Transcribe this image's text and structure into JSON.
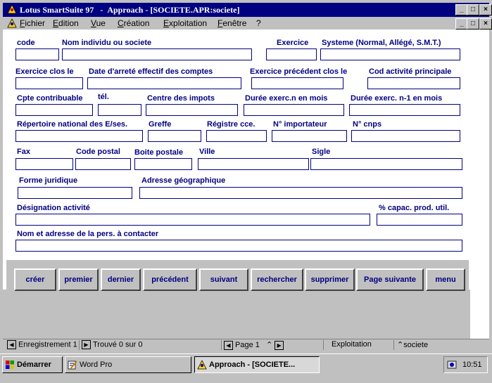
{
  "window": {
    "app_name": "Lotus SmartSuite 97",
    "separator": "-",
    "doc_title": "Approach - [SOCIETE.APR:societe]",
    "min_btn": "_",
    "max_btn": "□",
    "close_btn": "×"
  },
  "menu": {
    "items": [
      "Fichier",
      "Edition",
      "Vue",
      "Création",
      "Exploitation",
      "Fenêtre",
      "?"
    ],
    "doc_min": "_",
    "doc_max": "□",
    "doc_close": "×"
  },
  "form": {
    "labels": {
      "code": "code",
      "nom": "Nom individu ou societe",
      "exercice": "Exercice",
      "systeme": "Systeme (Normal, Allégé, S.M.T.)",
      "exercice_clos": "Exercice clos le",
      "date_arrete": "Date d'arreté effectif des comptes",
      "exercice_prec": "Exercice précédent clos le",
      "cod_activite": "Cod activité principale",
      "cpte": "Cpte contribuable",
      "tel": "tél.",
      "centre": "Centre des impots",
      "duree_n": "Durée exerc.n en mois",
      "duree_n1": "Durée exerc. n-1 en mois",
      "repertoire": "Répertoire national des E/ses.",
      "greffe": "Greffe",
      "registre": "Régistre cce.",
      "importateur": "N° importateur",
      "cnps": "N° cnps",
      "fax": "Fax",
      "code_postal": "Code postal",
      "boite_postale": "Boite postale",
      "ville": "Ville",
      "sigle": "Sigle",
      "forme_juridique": "Forme juridique",
      "adresse": "Adresse géographique",
      "designation": "Désignation activité",
      "capac": "% capac. prod. util.",
      "contact": "Nom et adresse de la pers. à contacter"
    },
    "values": {
      "code": "",
      "nom": "",
      "exercice": "",
      "systeme": "",
      "exercice_clos": "",
      "date_arrete": "",
      "exercice_prec": "",
      "cod_activite": "",
      "cpte": "",
      "tel": "",
      "centre": "",
      "duree_n": "",
      "duree_n1": "",
      "repertoire": "",
      "greffe": "",
      "registre": "",
      "importateur": "",
      "cnps": "",
      "fax": "",
      "code_postal": "",
      "boite_postale": "",
      "ville": "",
      "sigle": "",
      "forme_juridique": "",
      "adresse": "",
      "designation": "",
      "capac": "",
      "contact": ""
    }
  },
  "buttons": [
    "créer",
    "premier",
    "dernier",
    "précédent",
    "suivant",
    "rechercher",
    "supprimer",
    "Page suivante",
    "menu"
  ],
  "status": {
    "record": "Enregistrement 1",
    "found": "Trouvé 0 sur 0",
    "page": "Page 1",
    "mode": "Exploitation",
    "view": "societe"
  },
  "taskbar": {
    "start": "Démarrer",
    "word_pro": "Word Pro",
    "approach": "Approach - [SOCIETE...",
    "clock": "10:51"
  }
}
